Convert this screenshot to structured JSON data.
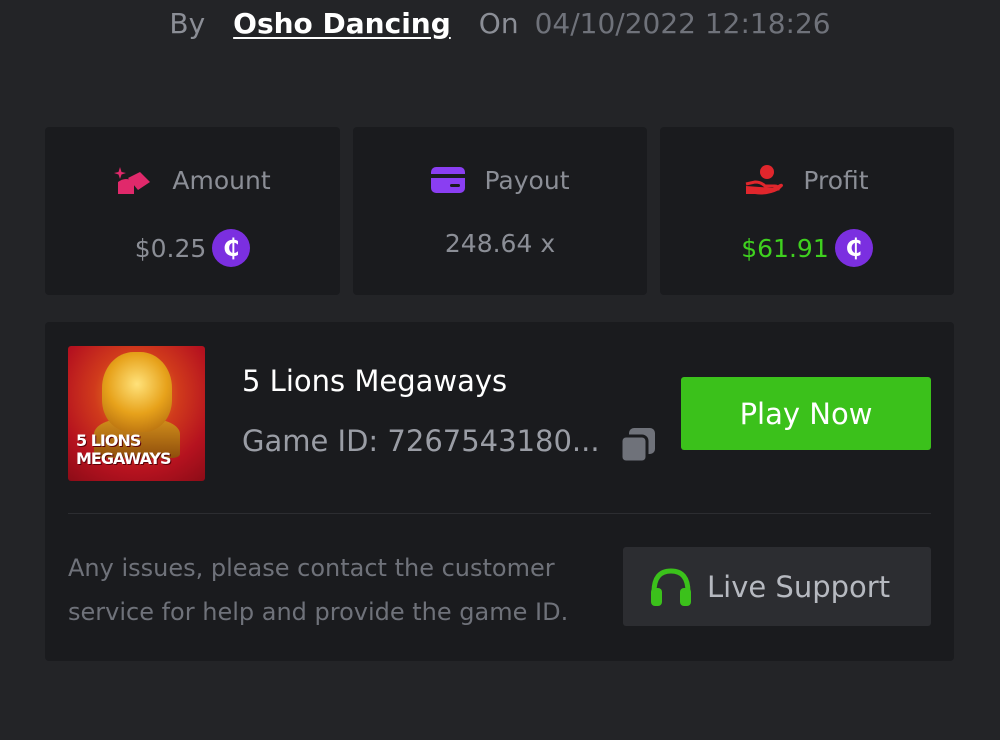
{
  "bet_meta": {
    "by_label": "By",
    "username": "Osho Dancing",
    "on_label": "On",
    "datetime": "04/10/2022 12:18:26"
  },
  "stats": {
    "amount": {
      "label": "Amount",
      "value": "$0.25",
      "icon": "amount-icon",
      "color": "#e0296b"
    },
    "payout": {
      "label": "Payout",
      "value": "248.64 x",
      "icon": "card-icon",
      "color": "#8a3ef2"
    },
    "profit": {
      "label": "Profit",
      "value": "$61.91",
      "icon": "hand-coin-icon",
      "color": "#e0262c",
      "value_color": "#3fd01f"
    },
    "coin_symbol": "₵"
  },
  "game": {
    "thumbnail_text": "5 LIONS MEGAWAYS",
    "title": "5 Lions Megaways",
    "id_text": "Game ID: 7267543180...",
    "play_label": "Play Now"
  },
  "support": {
    "help_text": "Any issues, please contact the customer service for help and provide the game ID.",
    "button_label": "Live Support"
  },
  "colors": {
    "background": "#232427",
    "card": "#1a1b1e",
    "accent_green": "#3bc11b",
    "coin_purple": "#7b2fe0"
  }
}
